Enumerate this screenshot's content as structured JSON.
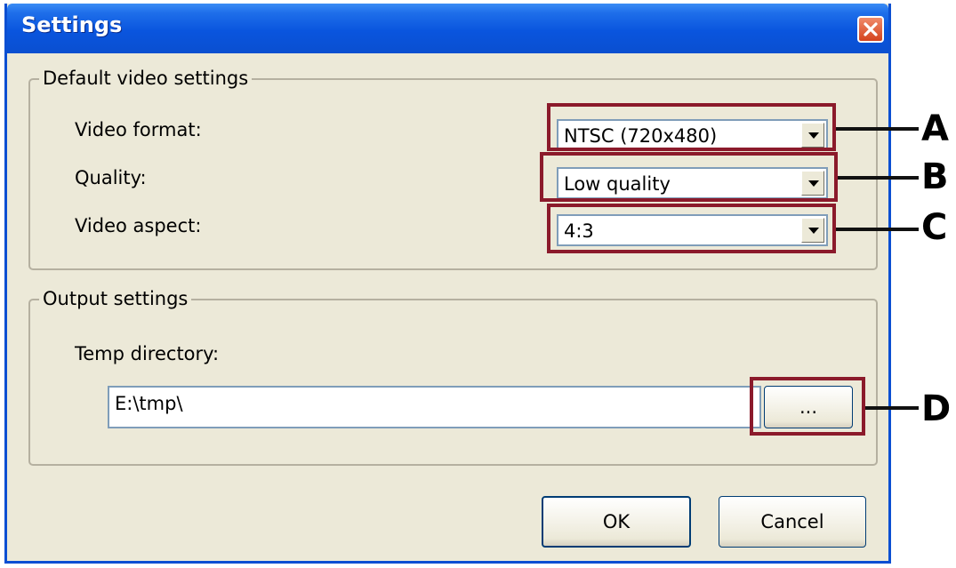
{
  "window": {
    "title": "Settings",
    "close_icon": "close-icon",
    "colors": {
      "titlebar": "#0a55de",
      "body": "#ece9d8",
      "callout": "#8b1a2b"
    }
  },
  "video_group": {
    "legend": "Default video settings",
    "format_label": "Video format:",
    "format_value": "NTSC (720x480)",
    "quality_label": "Quality:",
    "quality_value": "Low quality",
    "aspect_label": "Video aspect:",
    "aspect_value": "4:3"
  },
  "output_group": {
    "legend": "Output settings",
    "temp_label": "Temp directory:",
    "temp_value": "E:\\tmp\\",
    "browse_label": "..."
  },
  "buttons": {
    "ok": "OK",
    "cancel": "Cancel"
  },
  "callouts": [
    "A",
    "B",
    "C",
    "D"
  ]
}
